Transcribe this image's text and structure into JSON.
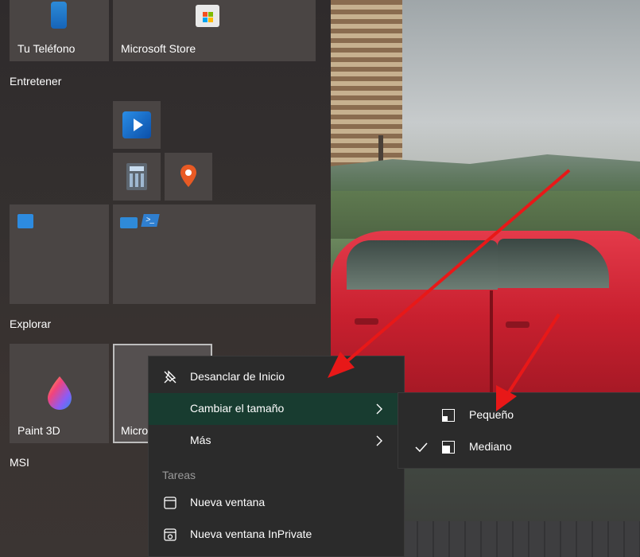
{
  "tiles": {
    "phone": {
      "label": "Tu Teléfono"
    },
    "store": {
      "label": "Microsoft Store"
    },
    "paint3d": {
      "label": "Paint 3D"
    },
    "selected": {
      "label": "Micro"
    }
  },
  "groups": {
    "entretener": "Entretener",
    "explorar": "Explorar",
    "msi": "MSI"
  },
  "context_menu": {
    "unpin": "Desanclar de Inicio",
    "resize": "Cambiar el tamaño",
    "more": "Más",
    "section_tasks": "Tareas",
    "new_window": "Nueva ventana",
    "new_inprivate": "Nueva ventana InPrivate"
  },
  "submenu": {
    "small": "Pequeño",
    "medium": "Mediano",
    "selected": "Mediano"
  },
  "colors": {
    "accent_highlight": "#183c30",
    "arrow": "#e81818",
    "menu_bg": "#2b2b2b",
    "tile_bg": "#4a4544"
  },
  "icons": {
    "phone": "phone-icon",
    "store": "store-icon",
    "movies": "movies-tv-icon",
    "calculator": "calculator-icon",
    "maps": "maps-icon",
    "calendar": "calendar-icon",
    "mail": "mail-icon",
    "powershell": "powershell-icon",
    "paint3d": "paint-3d-icon",
    "unpin": "unpin-icon",
    "chevron": "chevron-right-icon",
    "window": "window-icon",
    "inprivate": "inprivate-window-icon",
    "checkmark": "checkmark-icon"
  }
}
